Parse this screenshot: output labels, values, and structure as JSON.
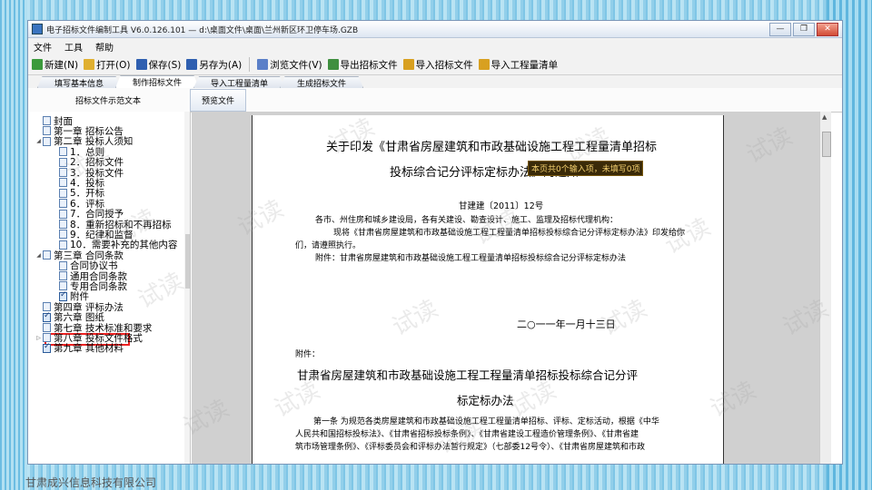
{
  "window": {
    "title": "电子招标文件编制工具 V6.0.126.101 — d:\\桌面文件\\桌面\\兰州新区环卫停车场.GZB",
    "minimize_icon": "minimize-icon",
    "maximize_icon": "maximize-icon",
    "close_icon": "close-icon"
  },
  "menu": [
    "文件",
    "工具",
    "帮助"
  ],
  "toolbar": [
    {
      "label": "新建(N)",
      "icon": "new-file-icon",
      "color": "#3c9a3c"
    },
    {
      "label": "打开(O)",
      "icon": "open-folder-icon",
      "color": "#e0b030"
    },
    {
      "label": "保存(S)",
      "icon": "save-icon",
      "color": "#2f5fb0"
    },
    {
      "label": "另存为(A)",
      "icon": "save-as-icon",
      "color": "#2f5fb0"
    },
    {
      "label": "浏览文件(V)",
      "icon": "browse-icon",
      "color": "#5a7fc8"
    },
    {
      "label": "导出招标文件",
      "icon": "export-icon",
      "color": "#3f8f3f"
    },
    {
      "label": "导入招标文件",
      "icon": "import-icon",
      "color": "#d8a020"
    },
    {
      "label": "导入工程量清单",
      "icon": "import-list-icon",
      "color": "#d8a020"
    }
  ],
  "tabs": [
    {
      "label": "填写基本信息",
      "active": false
    },
    {
      "label": "制作招标文件",
      "active": true
    },
    {
      "label": "导入工程量清单",
      "active": false
    },
    {
      "label": "生成招标文件",
      "active": false
    }
  ],
  "subbar": {
    "label": "招标文件示范文本",
    "preview_button": "预览文件"
  },
  "tree": [
    {
      "label": "封面",
      "level": 0,
      "expander": "",
      "checked": false
    },
    {
      "label": "第一章 招标公告",
      "level": 0,
      "expander": "",
      "checked": false
    },
    {
      "label": "第二章 投标人须知",
      "level": 0,
      "expander": "◢",
      "checked": false
    },
    {
      "label": "1．总则",
      "level": 1,
      "expander": "",
      "checked": false
    },
    {
      "label": "2．招标文件",
      "level": 1,
      "expander": "",
      "checked": false
    },
    {
      "label": "3．投标文件",
      "level": 1,
      "expander": "",
      "checked": false
    },
    {
      "label": "4．投标",
      "level": 1,
      "expander": "",
      "checked": false
    },
    {
      "label": "5．开标",
      "level": 1,
      "expander": "",
      "checked": false
    },
    {
      "label": "6．评标",
      "level": 1,
      "expander": "",
      "checked": false
    },
    {
      "label": "7．合同授予",
      "level": 1,
      "expander": "",
      "checked": false
    },
    {
      "label": "8．重新招标和不再招标",
      "level": 1,
      "expander": "",
      "checked": false
    },
    {
      "label": "9．纪律和监督",
      "level": 1,
      "expander": "",
      "checked": false
    },
    {
      "label": "10．需要补充的其他内容",
      "level": 1,
      "expander": "",
      "checked": false
    },
    {
      "label": "第三章 合同条款",
      "level": 0,
      "expander": "◢",
      "checked": false
    },
    {
      "label": "合同协议书",
      "level": 1,
      "expander": "",
      "checked": false
    },
    {
      "label": "通用合同条款",
      "level": 1,
      "expander": "",
      "checked": false
    },
    {
      "label": "专用合同条款",
      "level": 1,
      "expander": "",
      "checked": false
    },
    {
      "label": "附件",
      "level": 1,
      "expander": "",
      "checked": true
    },
    {
      "label": "第四章 评标办法",
      "level": 0,
      "expander": "",
      "checked": false,
      "highlighted": true
    },
    {
      "label": "第六章 图纸",
      "level": 0,
      "expander": "",
      "checked": true
    },
    {
      "label": "第七章 技术标准和要求",
      "level": 0,
      "expander": "",
      "checked": false
    },
    {
      "label": "第八章 投标文件格式",
      "level": 0,
      "expander": "▷",
      "checked": false
    },
    {
      "label": "第九章 其他材料",
      "level": 0,
      "expander": "",
      "checked": true
    }
  ],
  "company": "甘肃成兴信息科技有限公司",
  "document": {
    "title_line1": "关于印发《甘肃省房屋建筑和市政基础设施工程工程量清单招标",
    "title_line2": "投标综合记分评标定标办法》的通知",
    "tooltip": "本页共0个输入项，未填写0项",
    "doc_number": "甘建建〔2011〕12号",
    "recipients": "各市、州住房和城乡建设局，各有关建设、勘查设计、施工、监理及招标代理机构：",
    "body_line1": "现将《甘肃省房屋建筑和市政基础设施工程工程量清单招标投标综合记分评标定标办法》印发给你",
    "body_line2": "们，请遵照执行。",
    "attachment_line": "附件：甘肃省房屋建筑和市政基础设施工程工程量清单招标投标综合记分评标定标办法",
    "date": "二○一一年一月十三日",
    "attachment_label": "附件：",
    "attachment_title1": "甘肃省房屋建筑和市政基础设施工程工程量清单招标投标综合记分评",
    "attachment_title2": "标定标办法",
    "article1_line1": "第一条 为规范各类房屋建筑和市政基础设施工程工程量清单招标、评标、定标活动，根据《中华",
    "article1_line2": "人民共和国招标投标法》、《甘肃省招标投标条例》、《甘肃省建设工程造价管理条例》、《甘肃省建",
    "article1_line3": "筑市场管理条例》、《评标委员会和评标办法暂行规定》（七部委12号令）、《甘肃省房屋建筑和市政"
  },
  "watermark": "试读"
}
